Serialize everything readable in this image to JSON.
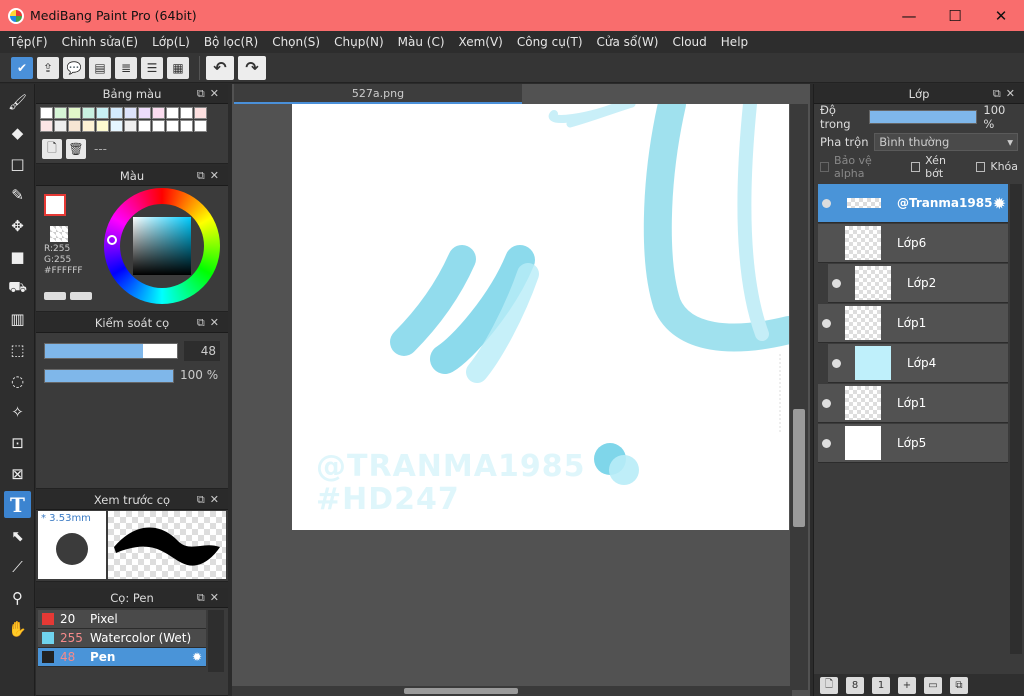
{
  "window": {
    "title": "MediBang Paint Pro (64bit)",
    "minimize": "—",
    "maximize": "☐",
    "close": "✕"
  },
  "menu": [
    "Tệp(F)",
    "Chỉnh sửa(E)",
    "Lớp(L)",
    "Bộ lọc(R)",
    "Chọn(S)",
    "Chụp(N)",
    "Màu (C)",
    "Xem(V)",
    "Công cụ(T)",
    "Cửa sổ(W)",
    "Cloud",
    "Help"
  ],
  "panels": {
    "palette": {
      "title": "Bảng màu",
      "value": "---"
    },
    "color": {
      "title": "Màu",
      "r": "R:255",
      "g": "G:255",
      "hex": "#FFFFFF"
    },
    "brush_control": {
      "title": "Kiểm soát cọ",
      "size": "48",
      "opacity": "100 %"
    },
    "brush_preview": {
      "title": "Xem trước cọ",
      "size_label": "* 3.53mm"
    },
    "brush_list": {
      "title": "Cọ: Pen",
      "items": [
        {
          "size": "20",
          "name": "Pixel",
          "color": "#e53935"
        },
        {
          "size": "255",
          "name": "Watercolor (Wet)",
          "color": "#6fd3ee"
        },
        {
          "size": "48",
          "name": "Pen",
          "color": "#222222"
        }
      ]
    }
  },
  "document": {
    "tab": "527a.png",
    "watermark_line1": "@TRANMA1985",
    "watermark_line2": "#HD247"
  },
  "layers_panel": {
    "title": "Lớp",
    "opacity_label": "Độ trong",
    "opacity_value": "100 %",
    "blend_label": "Pha trộn",
    "blend_value": "Bình thường",
    "protect_alpha": "Bảo vệ alpha",
    "clipping": "Xén bớt",
    "lock": "Khóa",
    "layers": [
      {
        "name": "@Tranma1985",
        "selected": true
      },
      {
        "name": "Lớp6"
      },
      {
        "name": "Lớp2"
      },
      {
        "name": "Lớp1"
      },
      {
        "name": "Lớp4"
      },
      {
        "name": "Lớp1"
      },
      {
        "name": "Lớp5"
      }
    ]
  },
  "colors": {
    "accent": "#4a94d8",
    "titlebar": "#f96d6d",
    "stroke": "#7fd6ea"
  }
}
